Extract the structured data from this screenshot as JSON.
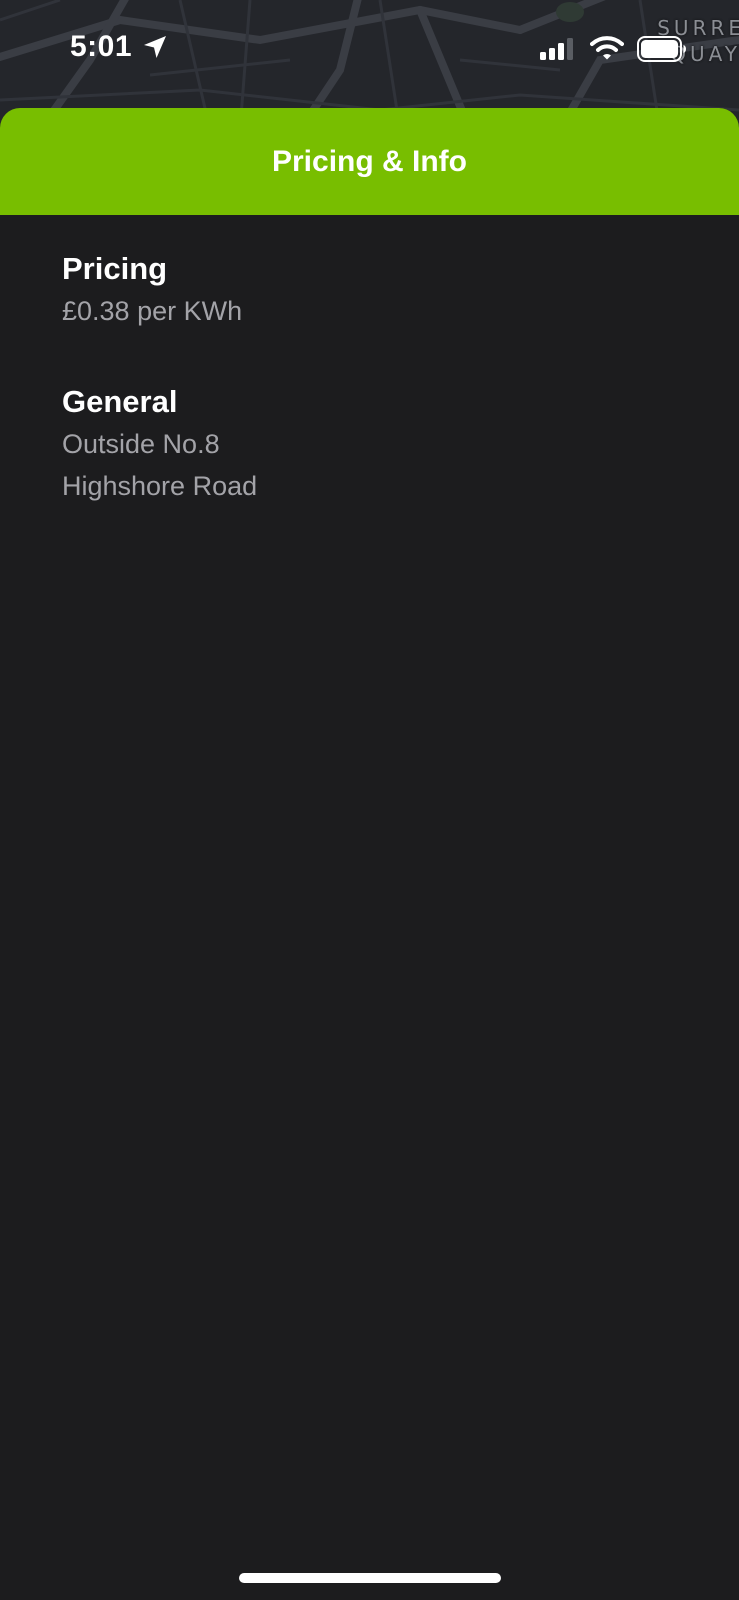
{
  "status_bar": {
    "time": "5:01",
    "location_icon": "location-arrow-icon",
    "signal_icon": "cellular-signal-icon",
    "wifi_icon": "wifi-icon",
    "battery_icon": "battery-icon"
  },
  "map": {
    "label_line1": "SURRE",
    "label_line2": "QUAY"
  },
  "sheet": {
    "title": "Pricing & Info",
    "accent_color": "#78be00",
    "background_color": "#1c1c1e",
    "sections": [
      {
        "heading": "Pricing",
        "lines": [
          "£0.38 per KWh"
        ]
      },
      {
        "heading": "General",
        "lines": [
          "Outside No.8",
          "Highshore Road"
        ]
      }
    ]
  }
}
